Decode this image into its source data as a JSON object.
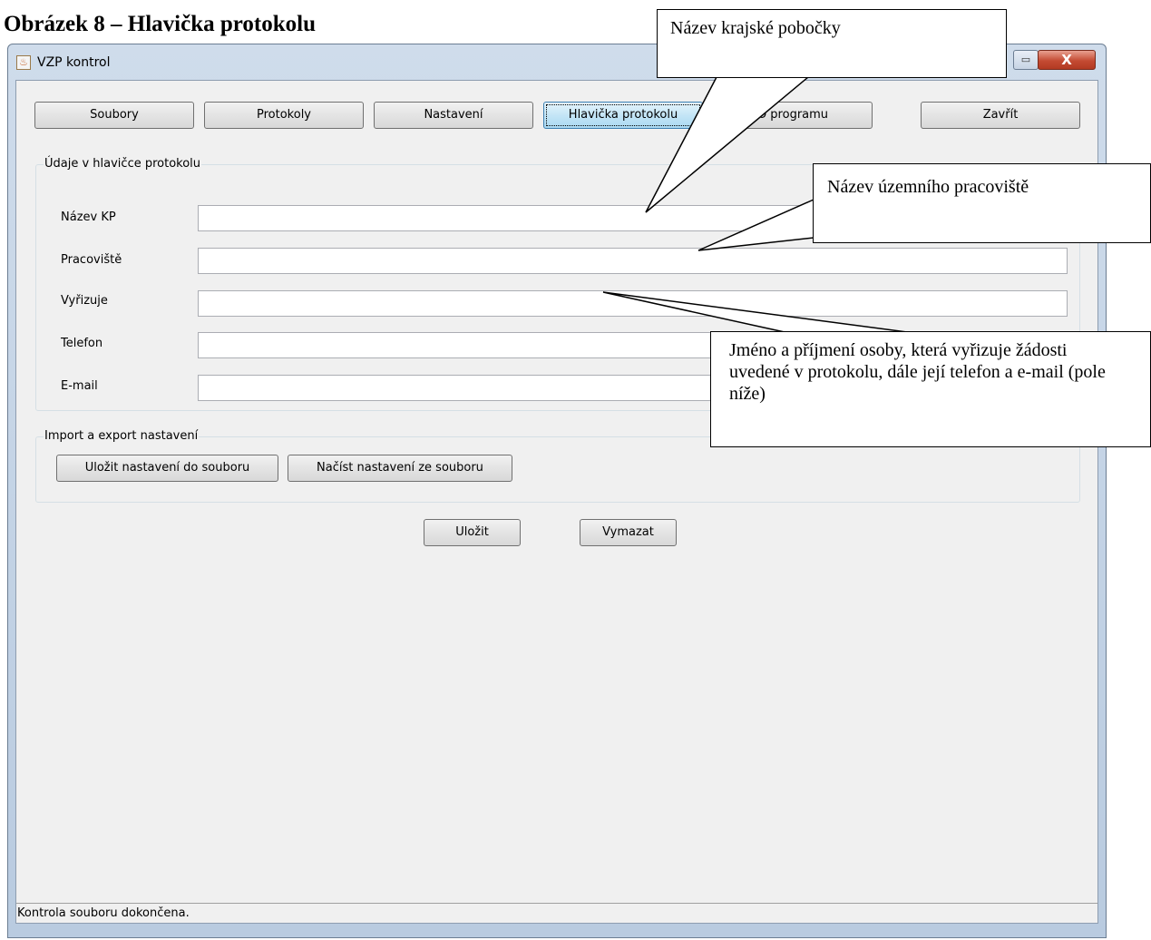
{
  "figure_caption": "Obrázek 8 – Hlavička protokolu",
  "window": {
    "title": "VZP kontrol",
    "icon": "java-icon",
    "close_glyph": "X",
    "maximize_glyph": "▭"
  },
  "toolbar": {
    "tabs": [
      {
        "label": "Soubory"
      },
      {
        "label": "Protokoly"
      },
      {
        "label": "Nastavení"
      },
      {
        "label": "Hlavička protokolu",
        "active": true
      },
      {
        "label": "O programu"
      },
      {
        "label": "Zavřít"
      }
    ]
  },
  "header_group": {
    "legend": "Údaje v hlavičce protokolu",
    "fields": [
      {
        "label": "Název KP",
        "value": ""
      },
      {
        "label": "Pracoviště",
        "value": ""
      },
      {
        "label": "Vyřizuje",
        "value": ""
      },
      {
        "label": "Telefon",
        "value": ""
      },
      {
        "label": "E-mail",
        "value": ""
      }
    ]
  },
  "import_export_group": {
    "legend": "Import a export nastavení",
    "save_to_file": "Uložit nastavení do souboru",
    "load_from_file": "Načíst nastavení ze souboru"
  },
  "actions": {
    "save": "Uložit",
    "clear": "Vymazat"
  },
  "status_bar": {
    "text": "Kontrola souboru dokončena."
  },
  "callouts": {
    "regional_branch": "Název krajské pobočky",
    "territorial_office": "Název územního pracoviště",
    "contact_person": "Jméno a příjmení osoby, která vyřizuje žádosti uvedené v protokolu, dále její telefon a e-mail (pole níže)"
  }
}
